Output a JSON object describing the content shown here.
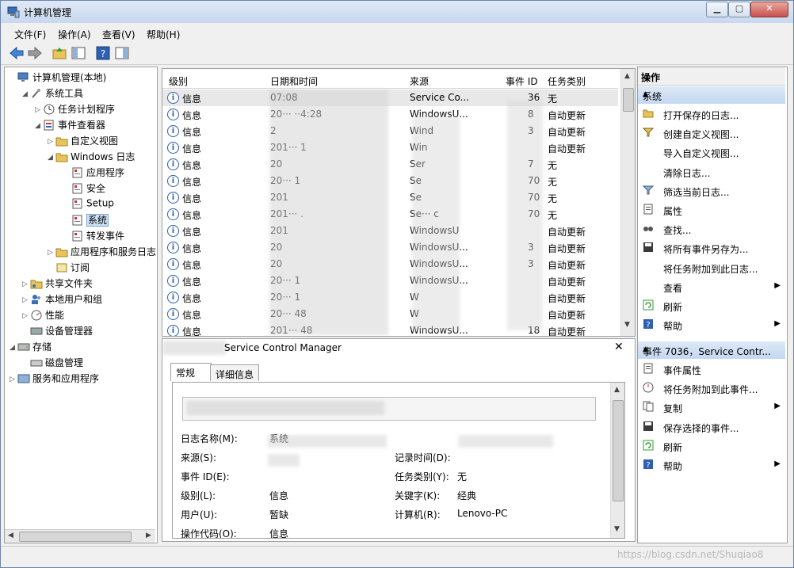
{
  "window": {
    "title": "计算机管理",
    "min": "▁",
    "max": "▢",
    "close": "✕"
  },
  "menu": [
    "文件(F)",
    "操作(A)",
    "查看(V)",
    "帮助(H)"
  ],
  "tree": [
    {
      "label": "计算机管理(本地)",
      "exp": "",
      "icon": "computer-icon"
    },
    {
      "label": "系统工具",
      "exp": "◢",
      "icon": "tools-icon"
    },
    {
      "label": "任务计划程序",
      "exp": "▷",
      "icon": "clock-icon"
    },
    {
      "label": "事件查看器",
      "exp": "◢",
      "icon": "event-viewer-icon"
    },
    {
      "label": "自定义视图",
      "exp": "▷",
      "icon": "folder-icon"
    },
    {
      "label": "Windows 日志",
      "exp": "◢",
      "icon": "folder-icon"
    },
    {
      "label": "应用程序",
      "exp": "",
      "icon": "log-icon"
    },
    {
      "label": "安全",
      "exp": "",
      "icon": "log-icon"
    },
    {
      "label": "Setup",
      "exp": "",
      "icon": "log-icon"
    },
    {
      "label": "系统",
      "exp": "",
      "icon": "log-icon"
    },
    {
      "label": "转发事件",
      "exp": "",
      "icon": "log-icon"
    },
    {
      "label": "应用程序和服务日志",
      "exp": "▷",
      "icon": "folder-icon"
    },
    {
      "label": "订阅",
      "exp": "",
      "icon": "subscription-icon"
    },
    {
      "label": "共享文件夹",
      "exp": "▷",
      "icon": "shared-folder-icon"
    },
    {
      "label": "本地用户和组",
      "exp": "▷",
      "icon": "users-icon"
    },
    {
      "label": "性能",
      "exp": "▷",
      "icon": "performance-icon"
    },
    {
      "label": "设备管理器",
      "exp": "",
      "icon": "device-manager-icon"
    },
    {
      "label": "存储",
      "exp": "◢",
      "icon": "storage-icon"
    },
    {
      "label": "磁盘管理",
      "exp": "",
      "icon": "disk-icon"
    },
    {
      "label": "服务和应用程序",
      "exp": "▷",
      "icon": "services-icon"
    }
  ],
  "events": {
    "columns": [
      "级别",
      "日期和时间",
      "来源",
      "事件 ID",
      "任务类别"
    ],
    "rows": [
      {
        "level": "信息",
        "date": "07:08",
        "source": "Service Co...",
        "id": "36",
        "category": "无"
      },
      {
        "level": "信息",
        "date": "20··· ··4:28",
        "source": "WindowsU...",
        "id": "8",
        "category": "自动更新"
      },
      {
        "level": "信息",
        "date": "2",
        "source": "Wind",
        "id": "3",
        "category": "自动更新"
      },
      {
        "level": "信息",
        "date": "201··· 1",
        "source": "Win",
        "id": "",
        "category": "自动更新"
      },
      {
        "level": "信息",
        "date": "20",
        "source": "Ser",
        "id": "7",
        "category": "无"
      },
      {
        "level": "信息",
        "date": "20··· 1",
        "source": "Se",
        "id": "70",
        "category": "无"
      },
      {
        "level": "信息",
        "date": "201",
        "source": "Se",
        "id": "70",
        "category": "无"
      },
      {
        "level": "信息",
        "date": "201··· .",
        "source": "Se··· c",
        "id": "70",
        "category": "无"
      },
      {
        "level": "信息",
        "date": "201",
        "source": "WindowsU",
        "id": "",
        "category": "自动更新"
      },
      {
        "level": "信息",
        "date": "20",
        "source": "WindowsU...",
        "id": "3",
        "category": "自动更新"
      },
      {
        "level": "信息",
        "date": "20",
        "source": "WindowsU...",
        "id": "3",
        "category": "自动更新"
      },
      {
        "level": "信息",
        "date": "20··· 1",
        "source": "WindowsU...",
        "id": "",
        "category": "自动更新"
      },
      {
        "level": "信息",
        "date": "20··· 1",
        "source": "W",
        "id": "",
        "category": "自动更新"
      },
      {
        "level": "信息",
        "date": "20··· 48",
        "source": "W",
        "id": "",
        "category": "自动更新"
      },
      {
        "level": "信息",
        "date": "201··· 48",
        "source": "WindowsU...",
        "id": "18",
        "category": "自动更新"
      }
    ]
  },
  "detail": {
    "header": "Service Control Manager",
    "tabs": [
      "常规",
      "详细信息"
    ],
    "fields_left": [
      {
        "label": "日志名称(M):",
        "value": "系统"
      },
      {
        "label": "来源(S):",
        "value": ""
      },
      {
        "label": "事件 ID(E):",
        "value": ""
      },
      {
        "label": "级别(L):",
        "value": "信息"
      },
      {
        "label": "用户(U):",
        "value": "暂缺"
      },
      {
        "label": "操作代码(O):",
        "value": "信息"
      }
    ],
    "fields_right": [
      {
        "label": "记录时间(D):",
        "value": ""
      },
      {
        "label": "任务类别(Y):",
        "value": "无"
      },
      {
        "label": "关键字(K):",
        "value": "经典"
      },
      {
        "label": "计算机(R):",
        "value": "Lenovo-PC"
      }
    ],
    "close": "✕"
  },
  "actions": {
    "title": "操作",
    "section1": "系统",
    "items1": [
      {
        "label": "打开保存的日志...",
        "icon": "open-folder-icon",
        "sub": ""
      },
      {
        "label": "创建自定义视图...",
        "icon": "filter-create-icon",
        "sub": ""
      },
      {
        "label": "导入自定义视图...",
        "icon": "",
        "sub": ""
      },
      {
        "label": "清除日志...",
        "icon": "",
        "sub": ""
      },
      {
        "label": "筛选当前日志...",
        "icon": "filter-icon",
        "sub": ""
      },
      {
        "label": "属性",
        "icon": "properties-icon",
        "sub": ""
      },
      {
        "label": "查找...",
        "icon": "find-icon",
        "sub": ""
      },
      {
        "label": "将所有事件另存为...",
        "icon": "save-icon",
        "sub": ""
      },
      {
        "label": "将任务附加到此日志...",
        "icon": "",
        "sub": ""
      },
      {
        "label": "查看",
        "icon": "",
        "sub": "▶"
      },
      {
        "label": "刷新",
        "icon": "refresh-icon",
        "sub": ""
      },
      {
        "label": "帮助",
        "icon": "help-icon",
        "sub": "▶"
      }
    ],
    "section2": "事件 7036，Service Contr...",
    "items2": [
      {
        "label": "事件属性",
        "icon": "properties-icon",
        "sub": ""
      },
      {
        "label": "将任务附加到此事件...",
        "icon": "task-icon",
        "sub": ""
      },
      {
        "label": "复制",
        "icon": "copy-icon",
        "sub": "▶"
      },
      {
        "label": "保存选择的事件...",
        "icon": "save-icon",
        "sub": ""
      },
      {
        "label": "刷新",
        "icon": "refresh-icon",
        "sub": ""
      },
      {
        "label": "帮助",
        "icon": "help-icon",
        "sub": "▶"
      }
    ]
  },
  "watermark": "https://blog.csdn.net/Shuqiao8",
  "colors": {
    "selection": "#cde2f7",
    "section_bar": "#c4d8f0",
    "info_blue": "#2d5fa8"
  }
}
